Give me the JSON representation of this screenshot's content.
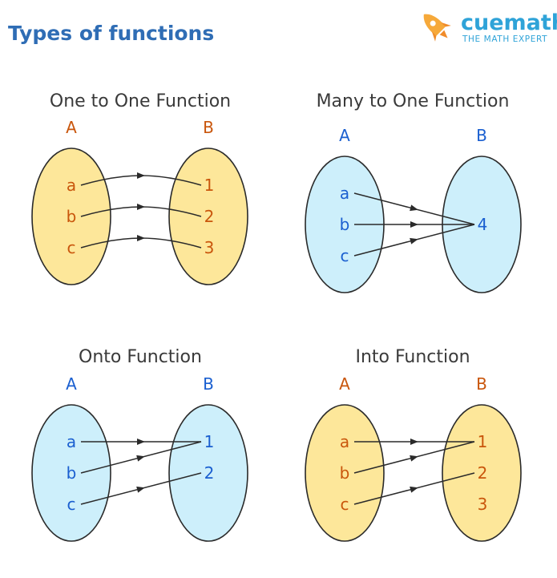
{
  "header": {
    "title": "Types of functions",
    "brand_name": "cuemath",
    "brand_tagline": "THE MATH EXPERT",
    "logo_icon": "rocket-icon"
  },
  "colors": {
    "title": "#2f6db5",
    "heading": "#3a3a3a",
    "brand": "#2fa3d8",
    "orange_text": "#c9560c",
    "blue_text": "#1a5fd0",
    "yellow_fill": "#fde79a",
    "blue_fill": "#cdeffb",
    "outline": "#2a2a2a",
    "arrow": "#2a2a2a",
    "rocket": "#f6a93a"
  },
  "diagrams": [
    {
      "title": "One to One Function",
      "scheme": "yellow",
      "set_a": {
        "label": "A",
        "elements": [
          "a",
          "b",
          "c"
        ]
      },
      "set_b": {
        "label": "B",
        "elements": [
          "1",
          "2",
          "3"
        ]
      },
      "mappings": [
        [
          0,
          0
        ],
        [
          1,
          1
        ],
        [
          2,
          2
        ]
      ]
    },
    {
      "title": "Many to One Function",
      "scheme": "blue",
      "set_a": {
        "label": "A",
        "elements": [
          "a",
          "b",
          "c"
        ]
      },
      "set_b": {
        "label": "B",
        "elements": [
          "4"
        ]
      },
      "mappings": [
        [
          0,
          0
        ],
        [
          1,
          0
        ],
        [
          2,
          0
        ]
      ]
    },
    {
      "title": "Onto Function",
      "scheme": "blue",
      "set_a": {
        "label": "A",
        "elements": [
          "a",
          "b",
          "c"
        ]
      },
      "set_b": {
        "label": "B",
        "elements": [
          "1",
          "2"
        ]
      },
      "mappings": [
        [
          0,
          0
        ],
        [
          1,
          0
        ],
        [
          2,
          1
        ]
      ]
    },
    {
      "title": "Into Function",
      "scheme": "yellow",
      "set_a": {
        "label": "A",
        "elements": [
          "a",
          "b",
          "c"
        ]
      },
      "set_b": {
        "label": "B",
        "elements": [
          "1",
          "2",
          "3"
        ]
      },
      "mappings": [
        [
          0,
          0
        ],
        [
          1,
          0
        ],
        [
          2,
          1
        ]
      ]
    }
  ]
}
